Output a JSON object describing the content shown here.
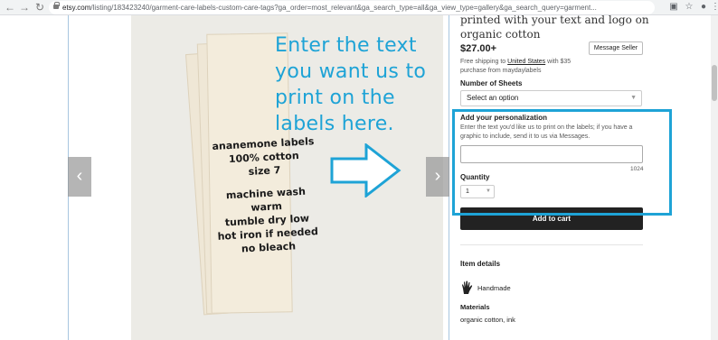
{
  "browser": {
    "url_host": "etsy.com",
    "url_path": "/listing/183423240/garment-care-labels-custom-care-tags?ga_order=most_relevant&ga_search_type=all&ga_view_type=gallery&ga_search_query=garment..."
  },
  "gallery": {
    "label_lines_1": [
      "ananemone labels",
      "100% cotton",
      "size 7"
    ],
    "label_lines_2": [
      "machine wash warm",
      "tumble dry low",
      "hot iron if needed",
      "no bleach"
    ],
    "prev_icon": "chevron-left-icon",
    "next_icon": "chevron-right-icon"
  },
  "annotation": {
    "lines": [
      "Enter the text",
      "you want us to",
      "print on the",
      "labels here."
    ],
    "color": "#1ea3d6"
  },
  "listing": {
    "title": "printed with your text and logo on organic cotton",
    "price": "$27.00+",
    "shipping_prefix": "Free shipping to ",
    "shipping_country": "United States",
    "shipping_suffix": " with $35 purchase from maydaylabels",
    "message_seller": "Message Seller",
    "sheets_label": "Number of Sheets",
    "sheets_value": "Select an option",
    "personal_label": "Add your personalization",
    "personal_help": "Enter the text you'd like us to print on the labels; if you have a graphic to include, send it to us via Messages.",
    "personal_value": "",
    "char_limit": "1024",
    "quantity_label": "Quantity",
    "quantity_value": "1",
    "add_to_cart": "Add to cart",
    "item_details": "Item details",
    "handmade": "Handmade",
    "materials_heading": "Materials",
    "materials_value": "organic cotton, ink"
  }
}
